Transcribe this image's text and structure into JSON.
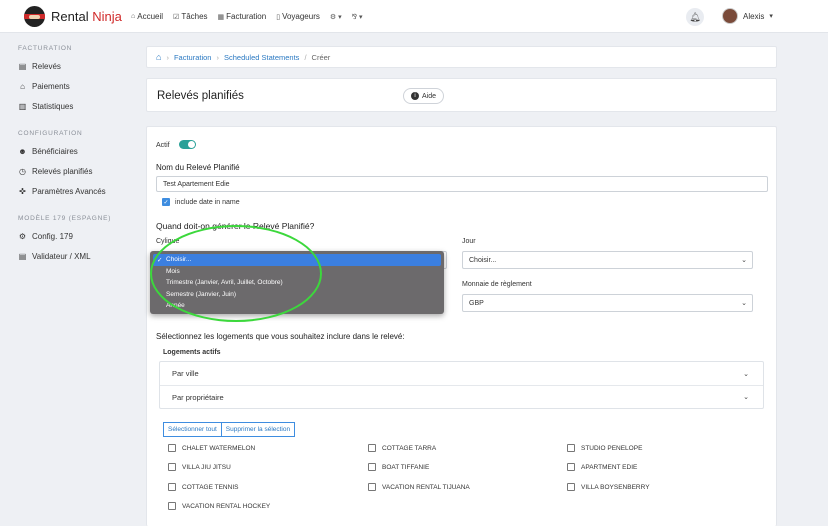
{
  "brand": {
    "name_part1": "Rental",
    "name_part2": "Ninja"
  },
  "nav": {
    "items": [
      {
        "icon": "home-icon",
        "glyph": "⌂",
        "label": "Accueil"
      },
      {
        "icon": "tasks-icon",
        "glyph": "☑",
        "label": "Tâches"
      },
      {
        "icon": "billing-icon",
        "glyph": "▦",
        "label": "Facturation"
      },
      {
        "icon": "luggage-icon",
        "glyph": "▯",
        "label": "Voyageurs"
      }
    ],
    "settings_glyph": "⚙ ▾",
    "lang_glyph": "⅋ ▾",
    "user_name": "Alexis"
  },
  "sidebar": {
    "sections": [
      {
        "title": "FACTURATION",
        "items": [
          {
            "icon": "statements-icon",
            "glyph": "▤",
            "label": "Relevés"
          },
          {
            "icon": "bank-icon",
            "glyph": "⌂",
            "label": "Paiements"
          },
          {
            "icon": "chart-icon",
            "glyph": "▥",
            "label": "Statistiques"
          }
        ]
      },
      {
        "title": "CONFIGURATION",
        "items": [
          {
            "icon": "users-icon",
            "glyph": "☻",
            "label": "Bénéficiaires"
          },
          {
            "icon": "alarm-clock-icon",
            "glyph": "◷",
            "label": "Relevés planifiés"
          },
          {
            "icon": "sliders-icon",
            "glyph": "✜",
            "label": "Paramètres Avancés"
          }
        ]
      },
      {
        "title": "MODÈLE 179 (ESPAGNE)",
        "items": [
          {
            "icon": "gear-icon",
            "glyph": "⚙",
            "label": "Config. 179"
          },
          {
            "icon": "file-code-icon",
            "glyph": "▤",
            "label": "Validateur / XML"
          }
        ]
      }
    ]
  },
  "breadcrumb": {
    "items": [
      "Facturation",
      "Scheduled Statements"
    ],
    "current": "Créer"
  },
  "page": {
    "title": "Relevés planifiés",
    "help_label": "Aide"
  },
  "form": {
    "active_label": "Actif",
    "name_label": "Nom du Relevé Planifié",
    "name_value": "Test Apartement Edie",
    "include_date_label": "include date in name",
    "when_question": "Quand doit-on générer le Relevé Planifié?",
    "cycle_label": "Cylique",
    "day_label": "Jour",
    "day_value": "Choisir...",
    "currency_label": "Monnaie de règlement",
    "currency_value": "GBP",
    "cycle_options": [
      "Choisir...",
      "Mois",
      "Trimestre (Janvier, Avril, Juillet, Octobre)",
      "Semestre (Janvier, Juin)",
      "Année"
    ],
    "cycle_selected": "Choisir...",
    "properties_question": "Sélectionnez les logements que vous souhaitez inclure dans le relevé:",
    "active_properties_label": "Logements actifs",
    "filters": [
      "Par ville",
      "Par propriétaire"
    ],
    "select_all_label": "Sélectionner tout",
    "clear_selection_label": "Supprimer la sélection",
    "properties": [
      "CHALET WATERMELON",
      "COTTAGE TARRA",
      "STUDIO PENELOPE",
      "VILLA JIU JITSU",
      "BOAT TIFFANIE",
      "APARTMENT EDIE",
      "COTTAGE TENNIS",
      "VACATION RENTAL TIJUANA",
      "VILLA BOYSENBERRY",
      "VACATION RENTAL HOCKEY"
    ]
  },
  "colors": {
    "accent": "#2b79c2",
    "toggle": "#2aa198",
    "highlight_ring": "#3cd83c",
    "brand_red": "#d02a2a"
  }
}
